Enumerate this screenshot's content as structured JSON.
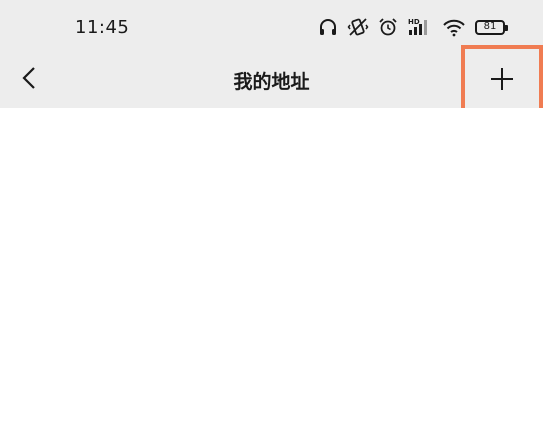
{
  "status_bar": {
    "time": "11:45",
    "icons": [
      "headphones-icon",
      "vibrate-off-icon",
      "alarm-icon",
      "hd-signal-icon",
      "wifi-icon",
      "battery-icon"
    ],
    "hd_label": "HD",
    "battery_level": "81"
  },
  "header": {
    "title": "我的地址",
    "back_icon": "chevron-left-icon",
    "add_icon": "plus-icon"
  },
  "colors": {
    "bar_background": "#ededed",
    "page_background": "#ffffff",
    "highlight_border": "#f07c52",
    "text": "#1a1a1a"
  }
}
